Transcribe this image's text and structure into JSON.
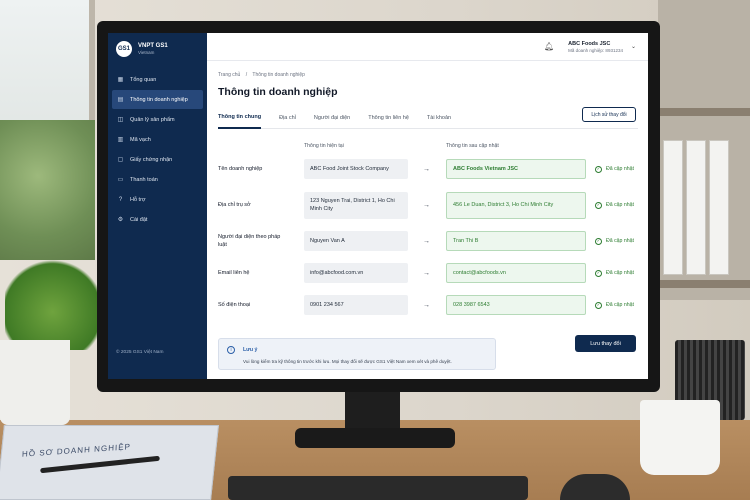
{
  "brand": {
    "name": "VNPT GS1",
    "sub": "Vietnam",
    "logo": "GS1"
  },
  "sidebar": {
    "items": [
      {
        "label": "Tổng quan",
        "icon": "dashboard-icon"
      },
      {
        "label": "Thông tin doanh nghiệp",
        "icon": "building-icon"
      },
      {
        "label": "Quản lý sản phẩm",
        "icon": "box-icon"
      },
      {
        "label": "Mã vạch",
        "icon": "barcode-icon"
      },
      {
        "label": "Giấy chứng nhận",
        "icon": "certificate-icon"
      },
      {
        "label": "Thanh toán",
        "icon": "payment-icon"
      },
      {
        "label": "Hỗ trợ",
        "icon": "help-icon"
      },
      {
        "label": "Cài đặt",
        "icon": "gear-icon"
      }
    ],
    "active_index": 1,
    "copyright": "© 2025 GS1 Việt Nam"
  },
  "header": {
    "company": "ABC Foods JSC",
    "company_id": "Mã doanh nghiệp: 8931234"
  },
  "breadcrumb": {
    "home": "Trang chủ",
    "sep": "/",
    "current": "Thông tin doanh nghiệp"
  },
  "page_title": "Thông tin doanh nghiệp",
  "tabs": [
    "Thông tin chung",
    "Địa chỉ",
    "Người đại diện",
    "Thông tin liên hệ",
    "Tài khoản"
  ],
  "history_button": "Lịch sử thay đổi",
  "columns": {
    "current": "Thông tin hiện tại",
    "updated": "Thông tin sau cập nhật"
  },
  "rows": [
    {
      "label": "Tên doanh nghiệp",
      "current": "ABC Food Joint Stock Company",
      "updated": "ABC Foods Vietnam JSC",
      "status": "Đã cập nhật"
    },
    {
      "label": "Địa chỉ trụ sở",
      "current": "123 Nguyen Trai, District 1, Ho Chi Minh City",
      "updated": "456 Le Duan, District 3, Ho Chi Minh City",
      "status": "Đã cập nhật"
    },
    {
      "label": "Người đại diện theo pháp luật",
      "current": "Nguyen Van A",
      "updated": "Tran Thi B",
      "status": "Đã cập nhật"
    },
    {
      "label": "Email liên hệ",
      "current": "info@abcfood.com.vn",
      "updated": "contact@abcfoods.vn",
      "status": "Đã cập nhật"
    },
    {
      "label": "Số điện thoại",
      "current": "0901 234 567",
      "updated": "028 3987 6543",
      "status": "Đã cập nhật"
    }
  ],
  "note": {
    "title": "Lưu ý",
    "text": "Vui lòng kiểm tra kỹ thông tin trước khi lưu. Mọi thay đổi sẽ được GS1 Việt Nam xem xét và phê duyệt."
  },
  "save_button": "Lưu thay đổi",
  "folder_text": "HỒ SƠ DOANH NGHIỆP"
}
